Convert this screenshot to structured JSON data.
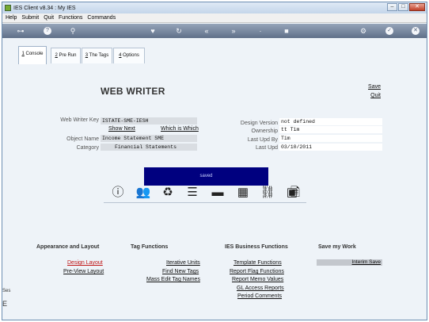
{
  "window": {
    "title": "IES Client v8.34 : My IES"
  },
  "menu": [
    "Help",
    "Submit",
    "Quit",
    "Functions",
    "Commands"
  ],
  "tabs": [
    {
      "label": "Console",
      "accel": "1"
    },
    {
      "label": "Pre Run",
      "accel": "2"
    },
    {
      "label": "The Tags",
      "accel": "3"
    },
    {
      "label": "Options",
      "accel": "4"
    }
  ],
  "page": {
    "title": "WEB WRITER",
    "save": "Save",
    "quit": "Quit"
  },
  "left_fields": {
    "key_label": "Web Writer Key",
    "key_value": "ISTATE-SME-IESH",
    "show_next": "Show Next",
    "which_is_which": "Which is Which",
    "object_label": "Object Name",
    "object_value": "Income Statement SME",
    "category_label": "Category",
    "category_value": "Financial Statements"
  },
  "right_fields": {
    "version_label": "Design Version",
    "version_value": "not defined",
    "ownership_label": "Ownership",
    "ownership_value": "tt Tim",
    "updby_label": "Last Upd By",
    "updby_value": "Tim",
    "upd_label": "Last Upd",
    "upd_value": "03/10/2011"
  },
  "banner": "saved",
  "sections": {
    "appearance": {
      "title": "Appearance and Layout",
      "links": [
        "Design Layout",
        "Pre-View Layout"
      ]
    },
    "tags": {
      "title": "Tag Functions",
      "links": [
        "Iterative Units",
        "Find New Tags",
        "Mass Edit Tag Names"
      ]
    },
    "business": {
      "title": "IES Business Functions",
      "links": [
        "Template Functions",
        "Report Flag Functions",
        "Report Memo Values",
        "GL Access Reports",
        "Period Comments"
      ]
    },
    "save": {
      "title": "Save my Work",
      "links": [
        "Interim Save"
      ]
    }
  },
  "left_edge": [
    "Ses",
    "E"
  ],
  "colors": {
    "banner": "#00007f",
    "toolbar": "#6b7c95",
    "active_link": "#c01818"
  }
}
